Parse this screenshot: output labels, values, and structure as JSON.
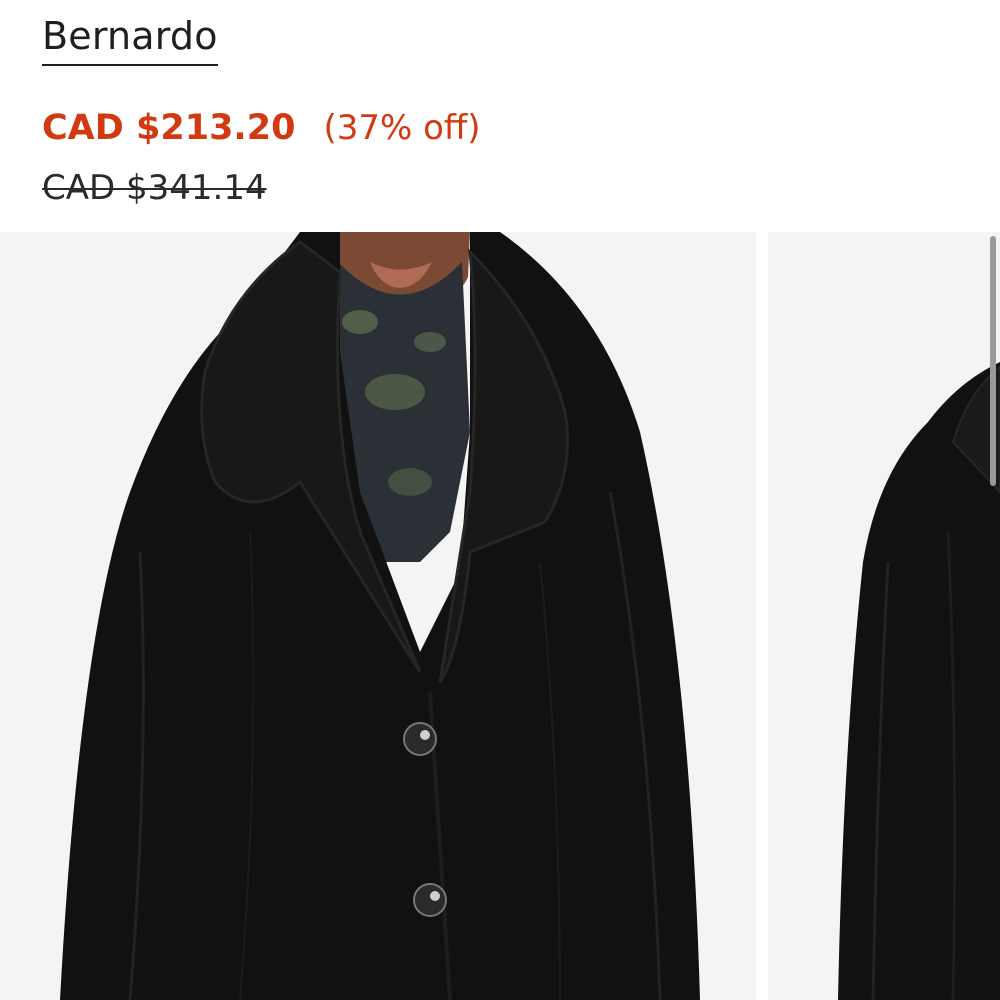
{
  "product": {
    "brand": "Bernardo",
    "sale_price": "CAD $213.20",
    "discount": "(37% off)",
    "original_price": "CAD $341.14"
  },
  "colors": {
    "sale": "#d13a10",
    "text": "#1f1f1f",
    "image_bg": "#f4f4f4"
  },
  "gallery": {
    "images": [
      "black-faux-fur-coat-front",
      "black-faux-fur-coat-side"
    ]
  }
}
